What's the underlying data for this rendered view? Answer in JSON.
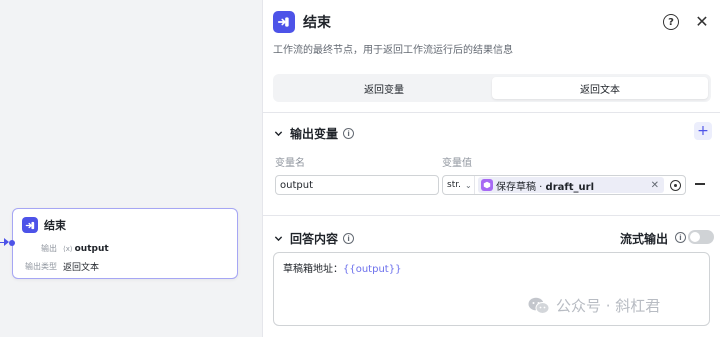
{
  "canvas": {
    "node": {
      "title": "结束",
      "output_label": "输出",
      "output_value": "output",
      "output_type_label": "输出类型",
      "output_type_value": "返回文本"
    }
  },
  "panel": {
    "title": "结束",
    "description": "工作流的最终节点，用于返回工作流运行后的结果信息",
    "tabs": [
      {
        "label": "返回变量",
        "active": false
      },
      {
        "label": "返回文本",
        "active": true
      }
    ],
    "output_section": {
      "title": "输出变量",
      "col_name": "变量名",
      "col_value": "变量值",
      "row": {
        "name": "output",
        "type": "str.",
        "ref_node": "保存草稿",
        "ref_sep": " · ",
        "ref_var": "draft_url"
      }
    },
    "answer_section": {
      "title": "回答内容",
      "stream_label": "流式输出",
      "stream_enabled": false,
      "content_prefix": "草稿箱地址：",
      "content_placeholder": "{{output}}"
    }
  },
  "watermark": {
    "text": "公众号 · 斜杠君"
  },
  "colors": {
    "accent": "#4d53e8",
    "ref_icon": "#a769f4",
    "node_border": "#a6a6f4"
  }
}
